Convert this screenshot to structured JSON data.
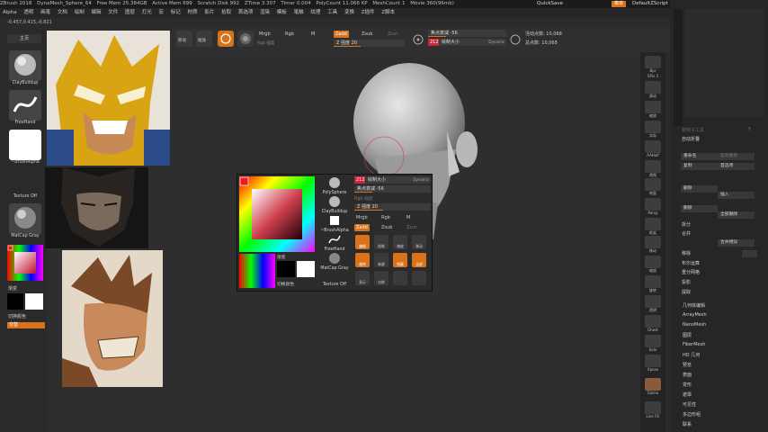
{
  "titlebar": {
    "items": [
      "ZBrush 2018",
      "DynaMesh_Sphere_64",
      "Free Mem 25.384GB",
      "Active Mem 699",
      "Scratch Disk 992",
      "ZTime 3.307",
      "Timer 0.004",
      "PolyCount 11.066 KP",
      "MeshCount 1",
      "Movie 360(96mb)"
    ],
    "quicksave": "QuickSave",
    "menus": "菜单",
    "script": "DefaultZScript"
  },
  "menubar": [
    "Alpha",
    "透明",
    "画笔",
    "文档",
    "绘制",
    "编辑",
    "文件",
    "图层",
    "灯光",
    "宏",
    "标记",
    "材质",
    "影片",
    "拾取",
    "首选项",
    "渲染",
    "模板",
    "笔触",
    "纹理",
    "工具",
    "变换",
    "Z插件",
    "Z脚本"
  ],
  "coords": "-0.457,0.415,-0.821",
  "toolbar": {
    "edit_label": "Edit",
    "draw_label": "Draw",
    "labels": [
      "移动",
      "缩放",
      "旋转"
    ],
    "mrgb": "Mrgb",
    "rgb": "Rgb",
    "m": "M",
    "rgb_intensity": "Rgb 强度",
    "zadd": "Zadd",
    "zsub": "Zsub",
    "zcut": "Zcut",
    "z_intensity": "Z 强度 20",
    "focal": "焦点衰减 -56",
    "draw_size": "212",
    "draw_size_label": "绘制大小",
    "dynamic": "Dynamic",
    "active_points": "活动点数: 10,068",
    "total_points": "总点数: 10,068"
  },
  "leftshelf": {
    "header": "主页",
    "brush1": "ClayBuildup",
    "brush2": "FreeHand",
    "alpha": "~BrushAlpha",
    "texture": "Texture Off",
    "material": "MatCap Gray",
    "gradient": "渐变",
    "switch": "切换颜色",
    "alternate": "交替"
  },
  "popup": {
    "tools": [
      "PolySphere",
      "ClayBuildup",
      "~BrushAlpha",
      "FreeHand",
      "MatCap Gray",
      "Texture Off"
    ],
    "size_value": "212",
    "size_label": "绘制大小",
    "dynamic": "Dynamic",
    "focal": "焦点衰减 -56",
    "rgb_intensity": "Rgb 强度",
    "z_intensity": "Z 强度 20",
    "mrgb": "Mrgb",
    "rgb": "Rgb",
    "m": "M",
    "zadd": "Zadd",
    "zsub": "Zsub",
    "zcut": "Zcut",
    "gradient": "渐变",
    "switch": "切换颜色",
    "buttons": [
      "编辑",
      "绘制",
      "缩放",
      "移动",
      "旋转",
      "新建",
      "隐藏",
      "全部",
      "显示",
      "对称"
    ]
  },
  "rtools": [
    "Bpr",
    "SPix 3",
    "滚动",
    "缩放",
    "实际",
    "AAHalf",
    "透视",
    "地面",
    "Persp",
    "框架",
    "移动",
    "缩放",
    "旋转",
    "透明",
    "Ghost",
    "Solo",
    "Xpose",
    "Gizmo",
    "Line Fill",
    "PolyF",
    "Transp",
    "Dynamic"
  ],
  "rpanel": {
    "rows": [
      [
        "复制子工具",
        "↑"
      ],
      [
        "自动折叠",
        ""
      ],
      [
        "重命名",
        "自动重新"
      ],
      [
        "复制",
        "首选项"
      ],
      [
        "删除",
        "插入"
      ],
      [
        "删除",
        "全部删除"
      ]
    ],
    "list": [
      "拆分",
      "合并",
      "合并相似",
      "移除",
      "布尔运算",
      "重分网格",
      "投影",
      "提取",
      "几何体编辑",
      "ArrayMesh",
      "NanoMesh",
      "图层",
      "FiberMesh",
      "HD 几何",
      "预览",
      "表面",
      "变形",
      "遮罩",
      "可见性",
      "多边形组",
      "联系"
    ]
  },
  "colors": {
    "accent": "#d8731c",
    "redbox": "#c4283b"
  }
}
